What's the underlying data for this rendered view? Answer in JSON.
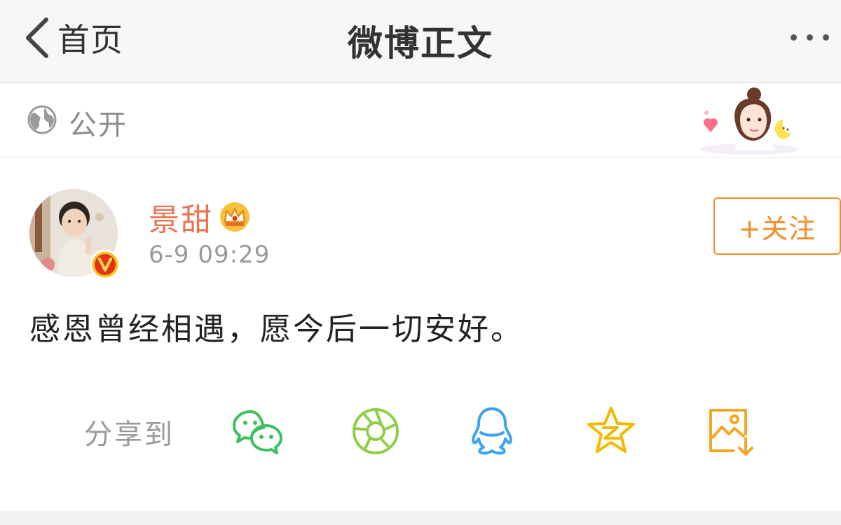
{
  "navbar": {
    "back_label": "首页",
    "title": "微博正文",
    "back_icon": "chevron-left-icon",
    "more_icon": "more-dots-icon"
  },
  "visibility": {
    "label": "公开",
    "icon": "globe-icon"
  },
  "post": {
    "username": "景甜",
    "timestamp": "6-9 09:29",
    "follow_label": "+关注",
    "content": "感恩曾经相遇，愿今后一切安好。",
    "badges": [
      "vip-crown-icon",
      "verified-v-icon"
    ],
    "colors": {
      "username": "#eb7350",
      "follow": "#f28c28",
      "verified": "#e8311a"
    }
  },
  "share": {
    "label": "分享到",
    "targets": [
      "wechat-icon",
      "moments-icon",
      "qq-icon",
      "qzone-icon",
      "save-image-icon"
    ]
  }
}
